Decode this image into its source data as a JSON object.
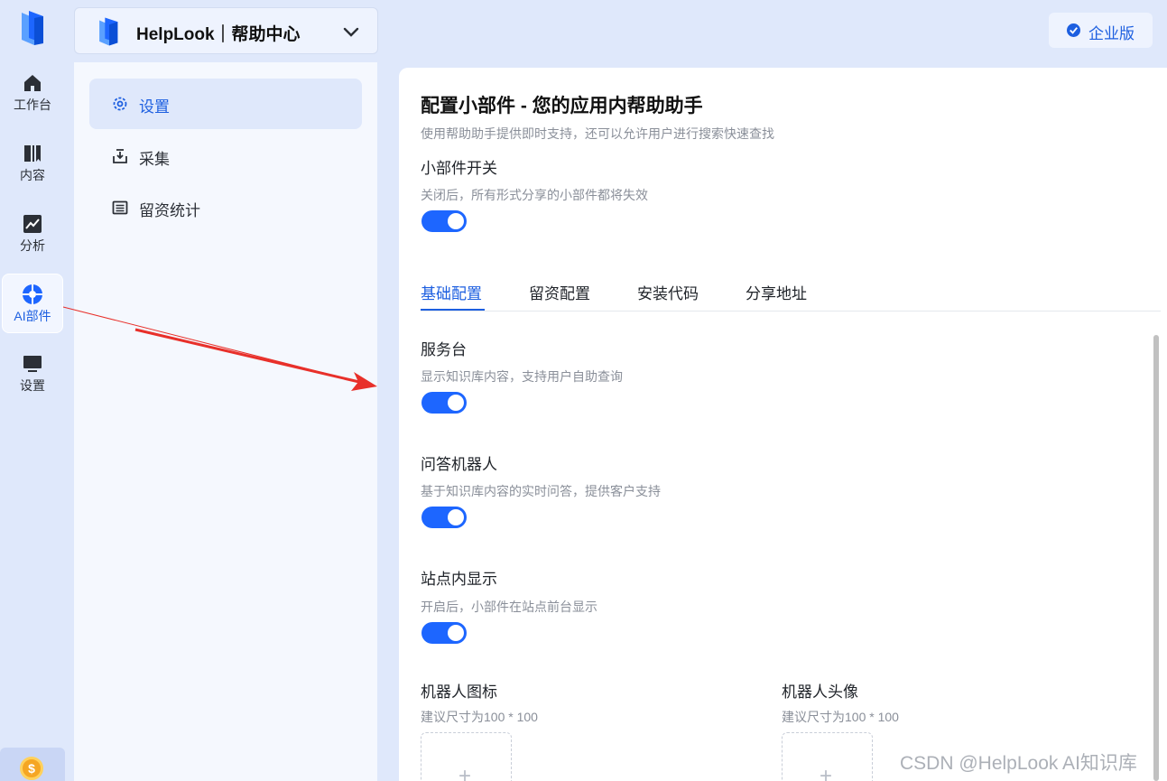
{
  "rail": {
    "items": [
      {
        "label": "工作台",
        "icon": "home-icon"
      },
      {
        "label": "内容",
        "icon": "book-icon"
      },
      {
        "label": "分析",
        "icon": "chart-icon"
      },
      {
        "label": "AI部件",
        "icon": "ai-widget-icon"
      },
      {
        "label": "设置",
        "icon": "monitor-icon"
      }
    ],
    "coin_symbol": "$"
  },
  "header": {
    "kb_title": "HelpLook｜帮助中心",
    "edition_label": "企业版"
  },
  "subnav": {
    "items": [
      {
        "label": "设置",
        "icon": "gear-icon"
      },
      {
        "label": "采集",
        "icon": "inbox-download-icon"
      },
      {
        "label": "留资统计",
        "icon": "list-icon"
      }
    ]
  },
  "main": {
    "title": "配置小部件 - 您的应用内帮助助手",
    "subtitle": "使用帮助助手提供即时支持，还可以允许用户进行搜索快速查找",
    "widget_switch": {
      "title": "小部件开关",
      "desc": "关闭后，所有形式分享的小部件都将失效",
      "on": true
    },
    "tabs": [
      "基础配置",
      "留资配置",
      "安装代码",
      "分享地址"
    ],
    "active_tab": "基础配置",
    "sections": [
      {
        "title": "服务台",
        "desc": "显示知识库内容，支持用户自助查询",
        "on": true
      },
      {
        "title": "问答机器人",
        "desc": "基于知识库内容的实时问答，提供客户支持",
        "on": true
      },
      {
        "title": "站点内显示",
        "desc": "开启后，小部件在站点前台显示",
        "on": true
      }
    ],
    "robot_icon": {
      "title": "机器人图标",
      "desc": "建议尺寸为100 * 100",
      "plus": "+"
    },
    "robot_avatar": {
      "title": "机器人头像",
      "desc": "建议尺寸为100 * 100",
      "plus": "+"
    }
  },
  "watermark": "CSDN @HelpLook AI知识库",
  "colors": {
    "accent": "#1d66ff",
    "arrow": "#e8302a",
    "background": "#dfe8fb"
  }
}
